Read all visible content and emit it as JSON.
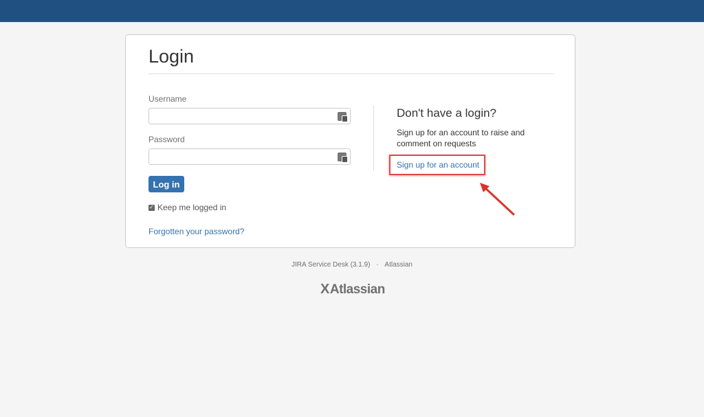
{
  "header": {
    "color": "#205081"
  },
  "login": {
    "title": "Login",
    "username_label": "Username",
    "username_value": "",
    "password_label": "Password",
    "password_value": "",
    "login_button": "Log in",
    "keep_logged_in": "Keep me logged in",
    "keep_logged_in_checked": true,
    "forgot_password": "Forgotten your password?"
  },
  "signup": {
    "title": "Don't have a login?",
    "description": "Sign up for an account to raise and comment on requests",
    "link": "Sign up for an account"
  },
  "footer": {
    "product": "JIRA Service Desk (3.1.9)",
    "separator": "·",
    "vendor": "Atlassian",
    "logo_text": "Atlassian",
    "logo_mark": "X"
  },
  "colors": {
    "accent": "#3572b0",
    "highlight": "#e04848"
  }
}
